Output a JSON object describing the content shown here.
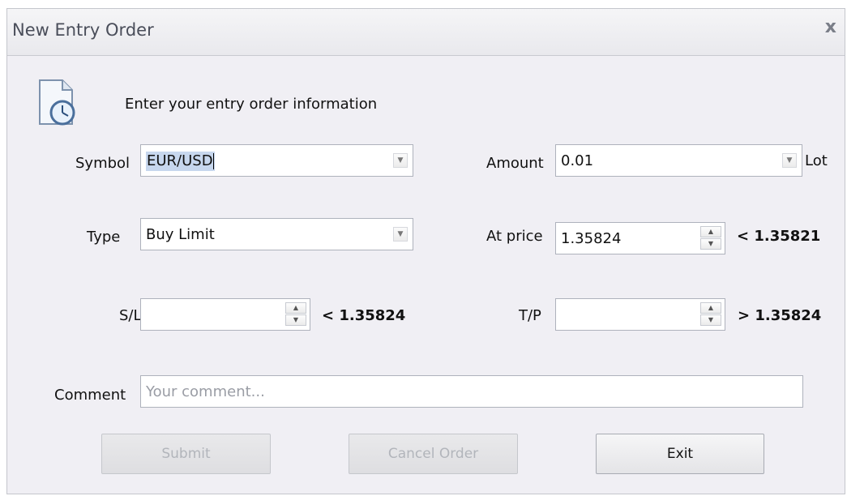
{
  "window": {
    "title": "New Entry Order",
    "close_glyph": "x"
  },
  "header": {
    "text": "Enter your entry order information",
    "icon": "document-clock-icon"
  },
  "symbol": {
    "label": "Symbol",
    "value": "EUR/USD"
  },
  "amount": {
    "label": "Amount",
    "value": "0.01",
    "unit": "Lot"
  },
  "type": {
    "label": "Type",
    "value": "Buy Limit"
  },
  "at_price": {
    "label": "At price",
    "value": "1.35824",
    "bound": "< 1.35821"
  },
  "sl": {
    "label": "S/L",
    "value": "",
    "bound": "< 1.35824"
  },
  "tp": {
    "label": "T/P",
    "value": "",
    "bound": "> 1.35824"
  },
  "comment": {
    "label": "Comment",
    "placeholder": "Your comment..."
  },
  "buttons": {
    "submit": "Submit",
    "cancel_order": "Cancel Order",
    "exit": "Exit"
  },
  "colors": {
    "dialog_bg": "#f0eff4",
    "selection": "#c7d7ee",
    "disabled_text": "#b2b5bb"
  }
}
